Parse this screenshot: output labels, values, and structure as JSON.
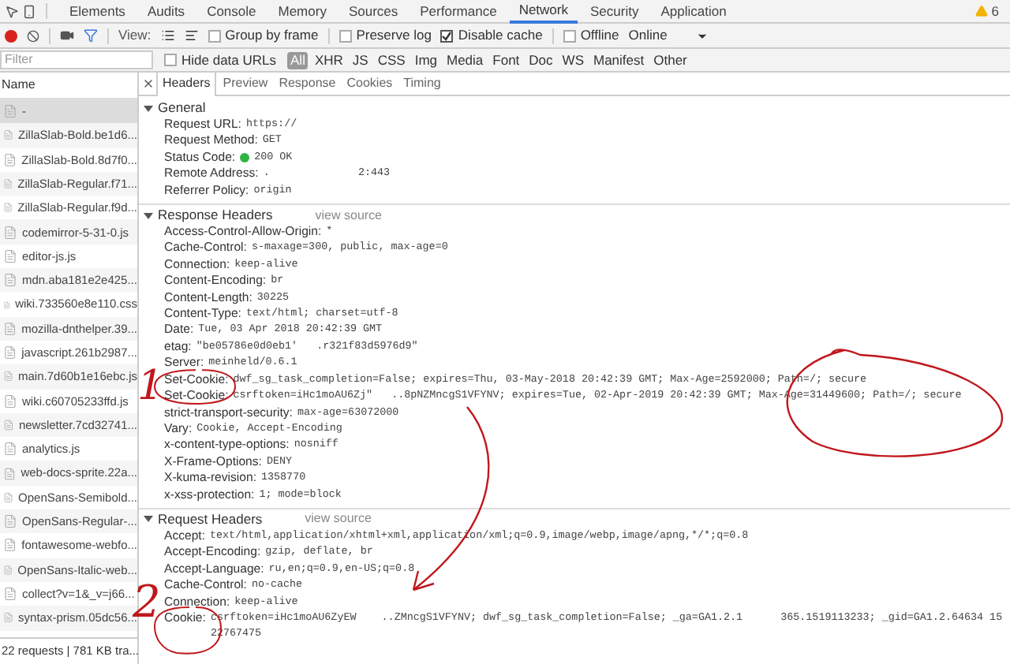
{
  "devtools_tabs": [
    {
      "label": "Elements",
      "selected": false
    },
    {
      "label": "Audits",
      "selected": false
    },
    {
      "label": "Console",
      "selected": false
    },
    {
      "label": "Memory",
      "selected": false
    },
    {
      "label": "Sources",
      "selected": false
    },
    {
      "label": "Performance",
      "selected": false
    },
    {
      "label": "Network",
      "selected": true
    },
    {
      "label": "Security",
      "selected": false
    },
    {
      "label": "Application",
      "selected": false
    }
  ],
  "warning_count": "6",
  "toolbar": {
    "recording": true,
    "view_label": "View:",
    "options": [
      {
        "label": "Group by frame",
        "checked": false
      },
      {
        "label": "Preserve log",
        "checked": false
      },
      {
        "label": "Disable cache",
        "checked": true
      },
      {
        "label": "Offline",
        "checked": false
      }
    ],
    "throttle": "Online"
  },
  "filter": {
    "placeholder": "Filter",
    "hide_data_urls": {
      "label": "Hide data URLs",
      "checked": false
    },
    "types": [
      {
        "label": "All",
        "selected": true
      },
      {
        "label": "XHR",
        "selected": false
      },
      {
        "label": "JS",
        "selected": false
      },
      {
        "label": "CSS",
        "selected": false
      },
      {
        "label": "Img",
        "selected": false
      },
      {
        "label": "Media",
        "selected": false
      },
      {
        "label": "Font",
        "selected": false
      },
      {
        "label": "Doc",
        "selected": false
      },
      {
        "label": "WS",
        "selected": false
      },
      {
        "label": "Manifest",
        "selected": false
      },
      {
        "label": "Other",
        "selected": false
      }
    ]
  },
  "requests": {
    "column": "Name",
    "rows": [
      {
        "name": "-",
        "selected": true
      },
      {
        "name": "ZillaSlab-Bold.be1d6...",
        "selected": false
      },
      {
        "name": "ZillaSlab-Bold.8d7f0...",
        "selected": false
      },
      {
        "name": "ZillaSlab-Regular.f71...",
        "selected": false
      },
      {
        "name": "ZillaSlab-Regular.f9d...",
        "selected": false
      },
      {
        "name": "codemirror-5-31-0.js",
        "selected": false
      },
      {
        "name": "editor-js.js",
        "selected": false
      },
      {
        "name": "mdn.aba181e2e425...",
        "selected": false
      },
      {
        "name": "wiki.733560e8e110.css",
        "selected": false
      },
      {
        "name": "mozilla-dnthelper.39...",
        "selected": false
      },
      {
        "name": "javascript.261b2987...",
        "selected": false
      },
      {
        "name": "main.7d60b1e16ebc.js",
        "selected": false
      },
      {
        "name": "wiki.c60705233ffd.js",
        "selected": false
      },
      {
        "name": "newsletter.7cd32741...",
        "selected": false
      },
      {
        "name": "analytics.js",
        "selected": false
      },
      {
        "name": "web-docs-sprite.22a...",
        "selected": false
      },
      {
        "name": "OpenSans-Semibold...",
        "selected": false
      },
      {
        "name": "OpenSans-Regular-...",
        "selected": false
      },
      {
        "name": "fontawesome-webfo...",
        "selected": false
      },
      {
        "name": "OpenSans-Italic-web...",
        "selected": false
      },
      {
        "name": "collect?v=1&_v=j66...",
        "selected": false
      },
      {
        "name": "syntax-prism.05dc56...",
        "selected": false
      }
    ]
  },
  "status_bar": "22 requests | 781 KB tra...",
  "detail_tabs": [
    {
      "label": "Headers",
      "selected": true
    },
    {
      "label": "Preview",
      "selected": false
    },
    {
      "label": "Response",
      "selected": false
    },
    {
      "label": "Cookies",
      "selected": false
    },
    {
      "label": "Timing",
      "selected": false
    }
  ],
  "sections": [
    {
      "title": "General",
      "expanded": true,
      "rows": [
        {
          "name": "Request URL:",
          "value": "https://"
        },
        {
          "name": "Request Method:",
          "value": "GET"
        },
        {
          "name": "Status Code:",
          "value": "200 OK",
          "kind": "status"
        },
        {
          "name": "Remote Address:",
          "value": ".              2:443"
        },
        {
          "name": "Referrer Policy:",
          "value": "origin"
        }
      ]
    },
    {
      "title": "Response Headers",
      "expanded": true,
      "view_source": "view source",
      "rows": [
        {
          "name": "Access-Control-Allow-Origin:",
          "value": "*"
        },
        {
          "name": "Cache-Control:",
          "value": "s-maxage=300, public, max-age=0"
        },
        {
          "name": "Connection:",
          "value": "keep-alive"
        },
        {
          "name": "Content-Encoding:",
          "value": "br"
        },
        {
          "name": "Content-Length:",
          "value": "30225"
        },
        {
          "name": "Content-Type:",
          "value": "text/html; charset=utf-8"
        },
        {
          "name": "Date:",
          "value": "Tue, 03 Apr 2018 20:42:39 GMT"
        },
        {
          "name": "etag:",
          "value": "\"be05786e0d0eb1'   .r321f83d5976d9\""
        },
        {
          "name": "Server:",
          "value": "meinheld/0.6.1"
        },
        {
          "name": "Set-Cookie:",
          "value": "dwf_sg_task_completion=False; expires=Thu, 03-May-2018 20:42:39 GMT; Max-Age=2592000; Path=/; secure"
        },
        {
          "name": "Set-Cookie:",
          "value": "csrftoken=iHc1moAU6Zj\"   ..8pNZMncgS1VFYNV; expires=Tue, 02-Apr-2019 20:42:39 GMT; Max-Age=31449600; Path=/; secure"
        },
        {
          "name": "strict-transport-security:",
          "value": "max-age=63072000"
        },
        {
          "name": "Vary:",
          "value": "Cookie, Accept-Encoding"
        },
        {
          "name": "x-content-type-options:",
          "value": "nosniff"
        },
        {
          "name": "X-Frame-Options:",
          "value": "DENY"
        },
        {
          "name": "X-kuma-revision:",
          "value": "1358770"
        },
        {
          "name": "x-xss-protection:",
          "value": "1; mode=block"
        }
      ]
    },
    {
      "title": "Request Headers",
      "expanded": true,
      "view_source": "view source",
      "rows": [
        {
          "name": "Accept:",
          "value": "text/html,application/xhtml+xml,application/xml;q=0.9,image/webp,image/apng,*/*;q=0.8"
        },
        {
          "name": "Accept-Encoding:",
          "value": "gzip, deflate, br"
        },
        {
          "name": "Accept-Language:",
          "value": "ru,en;q=0.9,en-US;q=0.8"
        },
        {
          "name": "Cache-Control:",
          "value": "no-cache"
        },
        {
          "name": "Connection:",
          "value": "keep-alive"
        },
        {
          "name": "Cookie:",
          "value": "csrftoken=iHc1moAU6ZyEW    ..ZMncgS1VFYNV; dwf_sg_task_completion=False; _ga=GA1.2.1      365.1519113233; _gid=GA1.2.64634 1522767475"
        }
      ]
    }
  ],
  "annotations": [
    {
      "label": "1"
    },
    {
      "label": "2"
    }
  ]
}
